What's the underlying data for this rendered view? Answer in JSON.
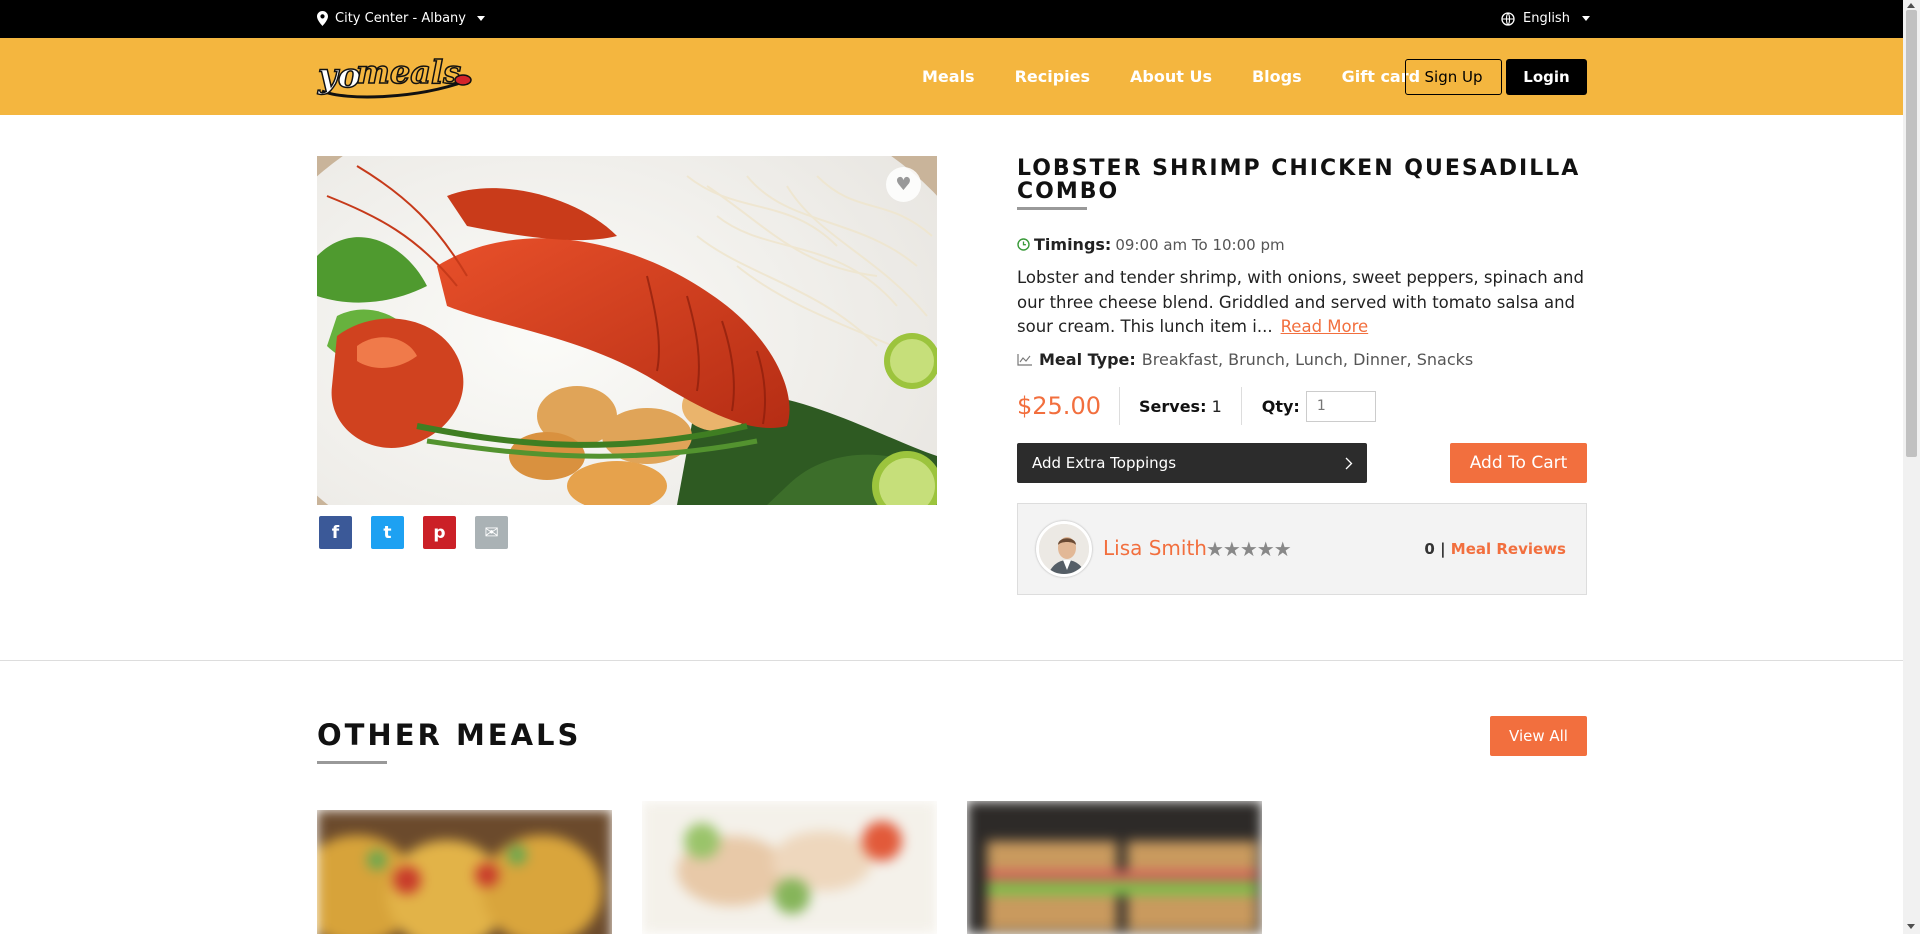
{
  "topbar": {
    "location": "City Center - Albany",
    "language": "English"
  },
  "header": {
    "logo_text": "yomeals",
    "nav": [
      "Meals",
      "Recipies",
      "About Us",
      "Blogs",
      "Gift card"
    ],
    "signup_label": "Sign Up",
    "login_label": "Login"
  },
  "product": {
    "title": "LOBSTER SHRIMP CHICKEN QUESADILLA COMBO",
    "timings_label": "Timings:",
    "timings_value": "09:00 am To 10:00 pm",
    "description": "Lobster and tender shrimp, with onions, sweet peppers, spinach and our three cheese blend. Griddled and served with tomato salsa and sour cream. This lunch item i...",
    "read_more": "Read More",
    "meal_type_label": "Meal Type:",
    "meal_type_value": "Breakfast, Brunch, Lunch, Dinner, Snacks",
    "price": "$25.00",
    "serves_label": "Serves:",
    "serves_value": "1",
    "qty_label": "Qty:",
    "qty_placeholder": "1",
    "toppings_label": "Add Extra Toppings",
    "add_to_cart": "Add To Cart",
    "chef_name": "Lisa Smith",
    "rating_stars": "★★★★★",
    "review_count": "0",
    "review_separator": "|",
    "reviews_link": "Meal Reviews"
  },
  "share": [
    "f",
    "t",
    "p",
    "✉"
  ],
  "other": {
    "title": "OTHER MEALS",
    "view_all": "View All"
  },
  "colors": {
    "accent": "#f26f3e",
    "header_bg": "#f4b63f",
    "facebook": "#3b5998",
    "twitter": "#1da1f2",
    "pinterest": "#cb2027",
    "email": "#aab2b5"
  }
}
